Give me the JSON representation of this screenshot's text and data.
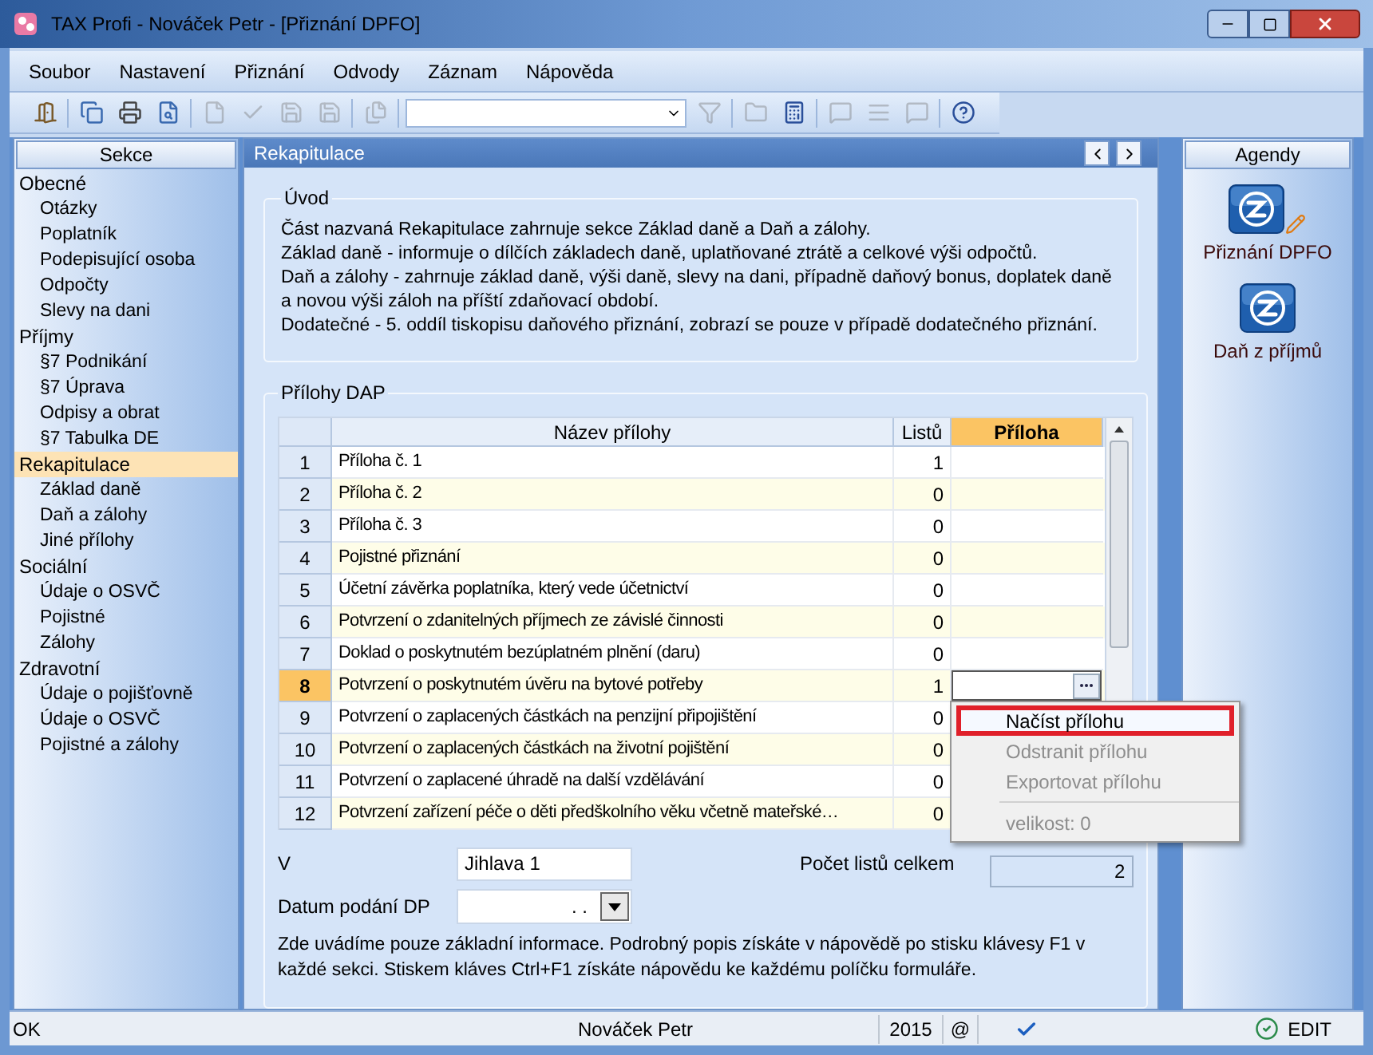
{
  "window": {
    "title": "TAX Profi - Nováček Petr - [Přiznání DPFO]"
  },
  "menu": [
    {
      "label": "Soubor"
    },
    {
      "label": "Nastavení"
    },
    {
      "label": "Přiznání"
    },
    {
      "label": "Odvody"
    },
    {
      "label": "Záznam"
    },
    {
      "label": "Nápověda"
    }
  ],
  "toolbar": [
    {
      "kind": "button",
      "disabled": false
    },
    {
      "kind": "separator"
    },
    {
      "kind": "button",
      "disabled": false
    },
    {
      "kind": "button",
      "disabled": false
    },
    {
      "kind": "button",
      "disabled": false
    },
    {
      "kind": "separator"
    },
    {
      "kind": "button",
      "disabled": true
    },
    {
      "kind": "button",
      "disabled": true
    },
    {
      "kind": "button",
      "disabled": true
    },
    {
      "kind": "button",
      "disabled": true
    },
    {
      "kind": "separator"
    },
    {
      "kind": "button",
      "disabled": true
    },
    {
      "kind": "separator"
    },
    {
      "kind": "combo"
    },
    {
      "kind": "button",
      "disabled": true
    },
    {
      "kind": "separator"
    },
    {
      "kind": "button",
      "disabled": true
    },
    {
      "kind": "button",
      "disabled": false
    },
    {
      "kind": "separator"
    },
    {
      "kind": "button",
      "disabled": true
    },
    {
      "kind": "button",
      "disabled": true
    },
    {
      "kind": "button",
      "disabled": true
    },
    {
      "kind": "separator"
    },
    {
      "kind": "button",
      "disabled": false
    }
  ],
  "sidebar": {
    "title": "Sekce",
    "items": [
      {
        "label": "Obecné",
        "selected": false,
        "children": [
          {
            "label": "Otázky",
            "selected": false
          },
          {
            "label": "Poplatník",
            "selected": false
          },
          {
            "label": "Podepisující osoba",
            "selected": false
          },
          {
            "label": "Odpočty",
            "selected": false
          },
          {
            "label": "Slevy na dani",
            "selected": false
          }
        ]
      },
      {
        "label": "Příjmy",
        "selected": false,
        "children": [
          {
            "label": "§7 Podnikání",
            "selected": false
          },
          {
            "label": "§7 Úprava",
            "selected": false
          },
          {
            "label": "Odpisy a obrat",
            "selected": false
          },
          {
            "label": "§7 Tabulka DE",
            "selected": false
          }
        ]
      },
      {
        "label": "Rekapitulace",
        "selected": true,
        "children": [
          {
            "label": "Základ daně",
            "selected": false
          },
          {
            "label": "Daň a zálohy",
            "selected": false
          },
          {
            "label": "Jiné přílohy",
            "selected": false
          }
        ]
      },
      {
        "label": "Sociální",
        "selected": false,
        "children": [
          {
            "label": "Údaje o OSVČ",
            "selected": false
          },
          {
            "label": "Pojistné",
            "selected": false
          },
          {
            "label": "Zálohy",
            "selected": false
          }
        ]
      },
      {
        "label": "Zdravotní",
        "selected": false,
        "children": [
          {
            "label": "Údaje o pojišťovně",
            "selected": false
          },
          {
            "label": "Údaje o OSVČ",
            "selected": false
          },
          {
            "label": "Pojistné a zálohy",
            "selected": false
          }
        ]
      }
    ]
  },
  "panel": {
    "title": "Rekapitulace",
    "intro": {
      "title": "Úvod",
      "lines": [
        "Část nazvaná Rekapitulace zahrnuje sekce Základ daně a Daň a zálohy.",
        "Základ daně  - informuje o dílčích základech daně, uplatňované ztrátě a celkové výši odpočtů.",
        "Daň a zálohy - zahrnuje základ daně, výši daně, slevy na dani, případně daňový bonus, doplatek daně a novou výši záloh na příští zdaňovací období.",
        "Dodatečné - 5. oddíl tiskopisu daňového přiznání, zobrazí se pouze v případě dodatečného přiznání."
      ]
    },
    "attachments": {
      "title": "Přílohy DAP",
      "columns": [
        {
          "label": "Název přílohy",
          "selected": false
        },
        {
          "label": "Listů",
          "selected": false
        },
        {
          "label": "Příloha",
          "selected": true
        }
      ],
      "rows": [
        {
          "number": "1",
          "name": "Příloha č. 1",
          "sheets": "1",
          "selected": false
        },
        {
          "number": "2",
          "name": "Příloha č. 2",
          "sheets": "0",
          "selected": false
        },
        {
          "number": "3",
          "name": "Příloha č. 3",
          "sheets": "0",
          "selected": false
        },
        {
          "number": "4",
          "name": "Pojistné přiznání",
          "sheets": "0",
          "selected": false
        },
        {
          "number": "5",
          "name": "Účetní závěrka poplatníka, který vede účetnictví",
          "sheets": "0",
          "selected": false
        },
        {
          "number": "6",
          "name": "Potvrzení o zdanitelných příjmech ze závislé činnosti",
          "sheets": "0",
          "selected": false
        },
        {
          "number": "7",
          "name": "Doklad o poskytnutém bezúplatném plnění (daru)",
          "sheets": "0",
          "selected": false
        },
        {
          "number": "8",
          "name": "Potvrzení o poskytnutém úvěru na bytové potřeby",
          "sheets": "1",
          "selected": true
        },
        {
          "number": "9",
          "name": "Potvrzení o zaplacených částkách na penzijní připojištění",
          "sheets": "0",
          "selected": false
        },
        {
          "number": "10",
          "name": "Potvrzení o zaplacených částkách na životní pojištění",
          "sheets": "0",
          "selected": false
        },
        {
          "number": "11",
          "name": "Potvrzení o zaplacené úhradě na další vzdělávání",
          "sheets": "0",
          "selected": false
        },
        {
          "number": "12",
          "name": "Potvrzení zařízení péče o děti předškolního věku včetně mateřské…",
          "sheets": "0",
          "selected": false
        }
      ],
      "context_menu": [
        {
          "kind": "item",
          "label": "Načíst přílohu",
          "disabled": false,
          "selected": true
        },
        {
          "kind": "item",
          "label": "Odstranit přílohu",
          "disabled": true,
          "selected": false
        },
        {
          "kind": "item",
          "label": "Exportovat přílohu",
          "disabled": true,
          "selected": false
        },
        {
          "kind": "separator"
        },
        {
          "kind": "item",
          "label": "velikost: 0",
          "disabled": true,
          "selected": false
        }
      ],
      "place_label": "V",
      "place_value": "Jihlava 1",
      "total_label": "Počet listů celkem",
      "total_value": "2",
      "date_label": "Datum podání DP",
      "date_value": ". .",
      "help": "Zde uvádíme pouze základní informace. Podrobný popis získáte v nápovědě po stisku klávesy F1 v každé sekci. Stiskem kláves Ctrl+F1 získáte nápovědu ke každému políčku formuláře."
    }
  },
  "agendas": {
    "title": "Agendy",
    "items": [
      {
        "label": "Přiznání DPFO",
        "editing": true
      },
      {
        "label": "Daň z příjmů",
        "editing": false
      }
    ]
  },
  "status_bar": {
    "message": "OK",
    "user": "Nováček Petr",
    "year": "2015",
    "at": "@",
    "mode": "EDIT"
  }
}
